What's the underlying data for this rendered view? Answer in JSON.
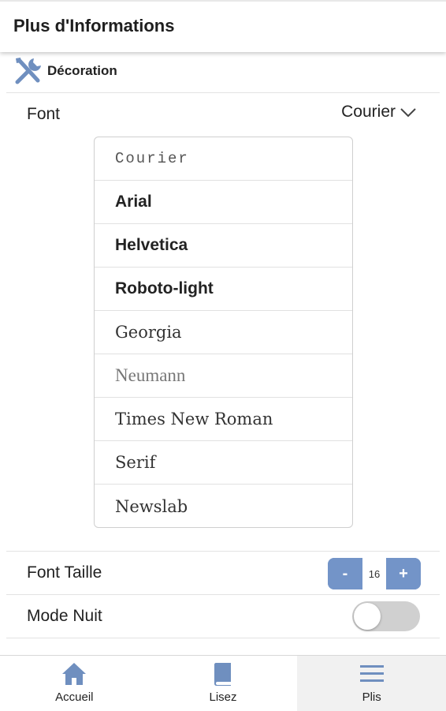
{
  "header": {
    "title": "Plus d'Informations"
  },
  "section": {
    "icon": "tools-icon",
    "label": "Décoration"
  },
  "font_setting": {
    "label": "Font",
    "selected": "Courier",
    "options": [
      "Courier",
      "Arial",
      "Helvetica",
      "Roboto-light",
      "Georgia",
      "Neumann",
      "Times New Roman",
      "Serif",
      "Newslab"
    ]
  },
  "font_size": {
    "label": "Font Taille",
    "minus": "-",
    "value": "16",
    "plus": "+"
  },
  "night_mode": {
    "label": "Mode Nuit",
    "enabled": false
  },
  "bottom_nav": {
    "items": [
      {
        "label": "Accueil",
        "icon": "home-icon"
      },
      {
        "label": "Lisez",
        "icon": "book-icon"
      },
      {
        "label": "Plis",
        "icon": "menu-icon",
        "active": true
      }
    ]
  },
  "colors": {
    "accent": "#7394c8",
    "icon": "#6f8fbf",
    "toggle_off": "#d0d0d0"
  }
}
